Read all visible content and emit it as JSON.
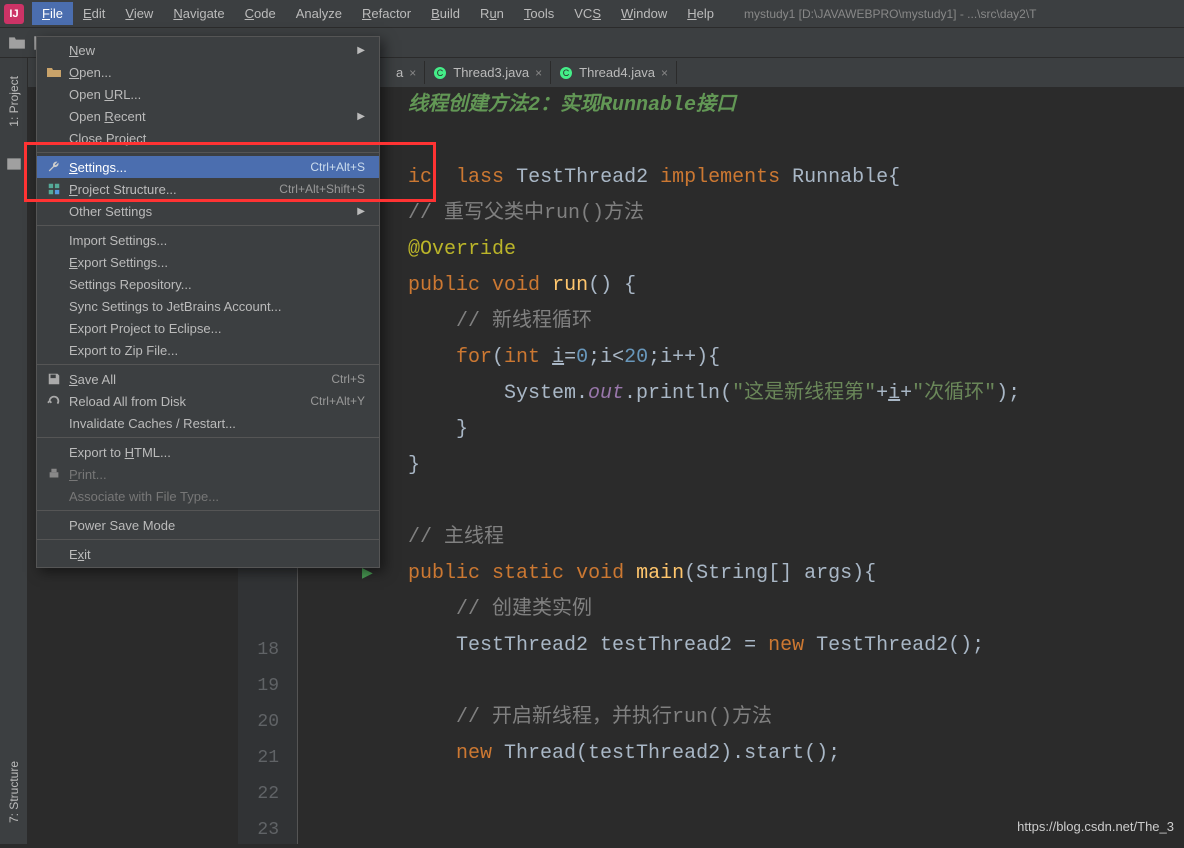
{
  "window_title": "mystudy1 [D:\\JAVAWEBPRO\\mystudy1] - ...\\src\\day2\\T",
  "menubar": [
    {
      "label": "File",
      "u": "F",
      "active": true
    },
    {
      "label": "Edit",
      "u": "E"
    },
    {
      "label": "View",
      "u": "V"
    },
    {
      "label": "Navigate",
      "u": "N"
    },
    {
      "label": "Code",
      "u": "C"
    },
    {
      "label": "Analyze"
    },
    {
      "label": "Refactor",
      "u": "R"
    },
    {
      "label": "Build",
      "u": "B"
    },
    {
      "label": "Run",
      "u": "u",
      "pre": "R"
    },
    {
      "label": "Tools",
      "u": "T"
    },
    {
      "label": "VCS",
      "u": "S",
      "pre": "VC"
    },
    {
      "label": "Window",
      "u": "W"
    },
    {
      "label": "Help",
      "u": "H"
    }
  ],
  "dropdown": {
    "groups": [
      [
        {
          "label": "New",
          "u": "N",
          "arrow": true
        },
        {
          "label": "Open...",
          "u": "O",
          "icon": "folder-open"
        },
        {
          "label": "Open URL...",
          "u": "U",
          "pre": "Open "
        },
        {
          "label": "Open Recent",
          "u": "R",
          "pre": "Open ",
          "arrow": true
        },
        {
          "label": "Close Project",
          "u": "j",
          "pre_raw": "Close Pro"
        }
      ],
      [
        {
          "label": "Settings...",
          "u": "S",
          "shortcut": "Ctrl+Alt+S",
          "icon": "wrench",
          "highlighted": true
        },
        {
          "label": "Project Structure...",
          "u": "P",
          "shortcut": "Ctrl+Alt+Shift+S",
          "icon": "project-structure"
        },
        {
          "label": "Other Settings",
          "arrow": true
        }
      ],
      [
        {
          "label": "Import Settings..."
        },
        {
          "label": "Export Settings...",
          "u": "E"
        },
        {
          "label": "Settings Repository..."
        },
        {
          "label": "Sync Settings to JetBrains Account..."
        },
        {
          "label": "Export Project to Eclipse..."
        },
        {
          "label": "Export to Zip File..."
        }
      ],
      [
        {
          "label": "Save All",
          "u": "S",
          "shortcut": "Ctrl+S",
          "icon": "save"
        },
        {
          "label": "Reload All from Disk",
          "shortcut": "Ctrl+Alt+Y",
          "icon": "reload"
        },
        {
          "label": "Invalidate Caches / Restart..."
        }
      ],
      [
        {
          "label": "Export to HTML...",
          "u": "H",
          "pre_raw": "Export to "
        },
        {
          "label": "Print...",
          "u": "P",
          "icon": "print",
          "disabled": true
        },
        {
          "label": "Associate with File Type...",
          "disabled": true
        }
      ],
      [
        {
          "label": "Power Save Mode"
        }
      ],
      [
        {
          "label": "Exit",
          "u": "x",
          "pre_raw": "E"
        }
      ]
    ]
  },
  "tabs": [
    {
      "label": "a",
      "partial": true
    },
    {
      "label": "Thread3.java"
    },
    {
      "label": "Thread4.java"
    }
  ],
  "sidebar": {
    "tabs": [
      "1: Project",
      "7: Structure"
    ]
  },
  "gutter": {
    "start": 18,
    "end": 23
  },
  "code": {
    "doc": "线程创建方法2：实现Runnable接口",
    "line1": {
      "kw1": "ic",
      "kw2": "lass",
      "cls": "TestThread2",
      "kw3": "implements",
      "iface": "Runnable",
      "brace": "{"
    },
    "cm1": "// 重写父类中run()方法",
    "ann": "@Override",
    "line3": {
      "kw1": "public",
      "kw2": "void",
      "fn": "run",
      "rest": "() {"
    },
    "cm2": "// 新线程循环",
    "line4": {
      "kw": "for",
      "o": "(",
      "ty": "int",
      "var": "i",
      "eq": "=",
      "n0": "0",
      "semi": ";i<",
      "n1": "20",
      "semi2": ";i++){"
    },
    "line5": {
      "pre": "System.",
      "out": "out",
      "mid": ".println(",
      "s1": "\"这是新线程第\"",
      "plus1": "+",
      "var": "i",
      "plus2": "+",
      "s2": "\"次循环\"",
      "end": ");"
    },
    "brace1": "}",
    "brace2": "}",
    "cm3": "// 主线程",
    "line6": {
      "kw1": "public",
      "kw2": "static",
      "kw3": "void",
      "fn": "main",
      "rest": "(String[] args){"
    },
    "cm4": "// 创建类实例",
    "line7": "TestThread2 testThread2 = ",
    "line7kw": "new",
    "line7rest": " TestThread2();",
    "cm5": "// 开启新线程，并执行run()方法",
    "line8": {
      "kw": "new",
      "rest": " Thread(testThread2).start();"
    }
  },
  "watermark": "https://blog.csdn.net/The_3"
}
